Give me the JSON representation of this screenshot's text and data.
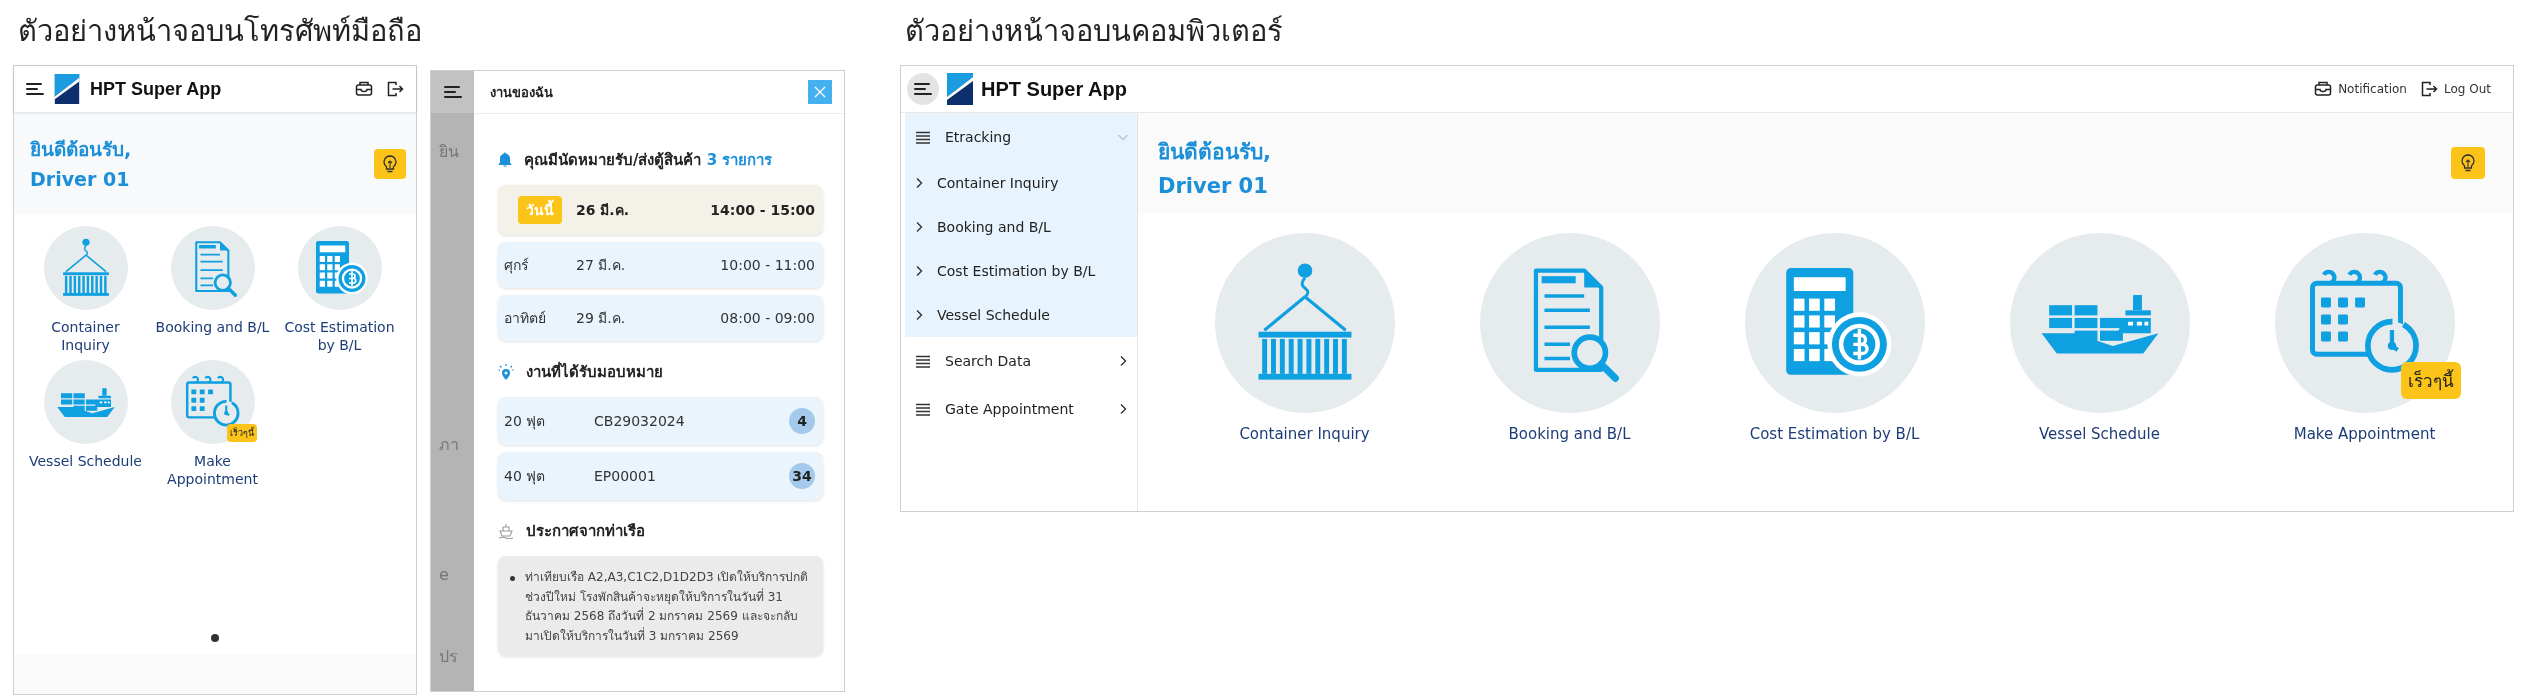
{
  "mobile_section": {
    "title": "ตัวอย่างหน้าจอบนโทรศัพท์มือถือ"
  },
  "mobile_home": {
    "app_title": "HPT Super App",
    "welcome_line1": "ยินดีต้อนรับ,",
    "welcome_line2": "Driver 01",
    "tiles": [
      {
        "kind": "container",
        "label": "Container Inquiry"
      },
      {
        "kind": "booking",
        "label": "Booking and B/L"
      },
      {
        "kind": "cost",
        "label": "Cost Estimation by B/L"
      },
      {
        "kind": "vessel",
        "label": "Vessel Schedule"
      },
      {
        "kind": "appointment",
        "label": "Make Appointment",
        "badge": "เร็วๆนี้"
      }
    ],
    "page_dots": [
      {
        "selected": true
      }
    ]
  },
  "mobile_tasks": {
    "background_fragments": [
      "ยิน",
      "ภา",
      "e",
      "ปร"
    ],
    "panel": {
      "title": "งานของฉัน",
      "appointments_heading": "คุณมีนัดหมายรับ/ส่งตู้สินค้า",
      "appointments_count": "3 รายการ",
      "appointments": [
        {
          "day": "วันนี้",
          "date": "26 มี.ค.",
          "time": "14:00 - 15:00",
          "today": true
        },
        {
          "day": "ศุกร์",
          "date": "27 มี.ค.",
          "time": "10:00 - 11:00",
          "today": false
        },
        {
          "day": "อาทิตย์",
          "date": "29 มี.ค.",
          "time": "08:00 - 09:00",
          "today": false
        }
      ],
      "assigned_heading": "งานที่ได้รับมอบหมาย",
      "assignments": [
        {
          "size": "20 ฟุต",
          "number": "CB29032024",
          "count": "4"
        },
        {
          "size": "40 ฟุต",
          "number": "EP00001",
          "count": "34"
        }
      ],
      "announcements_heading": "ประกาศจากท่าเรือ",
      "announcements": [
        "ท่าเทียบเรือ A2,A3,C1C2,D1D2D3 เปิดให้บริการปกติช่วงปีใหม่ โรงพักสินค้าจะหยุดให้บริการในวันที่ 31 ธันวาคม 2568 ถึงวันที่ 2 มกราคม 2569 และจะกลับมาเปิดให้บริการในวันที่ 3 มกราคม 2569"
      ]
    }
  },
  "desktop_section": {
    "title": "ตัวอย่างหน้าจอบนคอมพิวเตอร์"
  },
  "desktop_app": {
    "app_title": "HPT Super App",
    "header_links": [
      {
        "kind": "notification",
        "label": "Notification"
      },
      {
        "kind": "logout",
        "label": "Log Out"
      }
    ],
    "sidebar": {
      "items": [
        {
          "label": "Etracking",
          "expanded": true,
          "children": [
            {
              "label": "Container Inquiry"
            },
            {
              "label": "Booking and B/L"
            },
            {
              "label": "Cost Estimation by B/L"
            },
            {
              "label": "Vessel Schedule"
            }
          ]
        },
        {
          "label": "Search Data",
          "expanded": false
        },
        {
          "label": "Gate Appointment",
          "expanded": false
        }
      ]
    },
    "welcome_line1": "ยินดีต้อนรับ,",
    "welcome_line2": "Driver 01",
    "tiles": [
      {
        "kind": "container",
        "label": "Container Inquiry"
      },
      {
        "kind": "booking",
        "label": "Booking and B/L"
      },
      {
        "kind": "cost",
        "label": "Cost Estimation by B/L"
      },
      {
        "kind": "vessel",
        "label": "Vessel Schedule"
      },
      {
        "kind": "appointment",
        "label": "Make Appointment",
        "badge": "เร็วๆนี้"
      }
    ]
  }
}
